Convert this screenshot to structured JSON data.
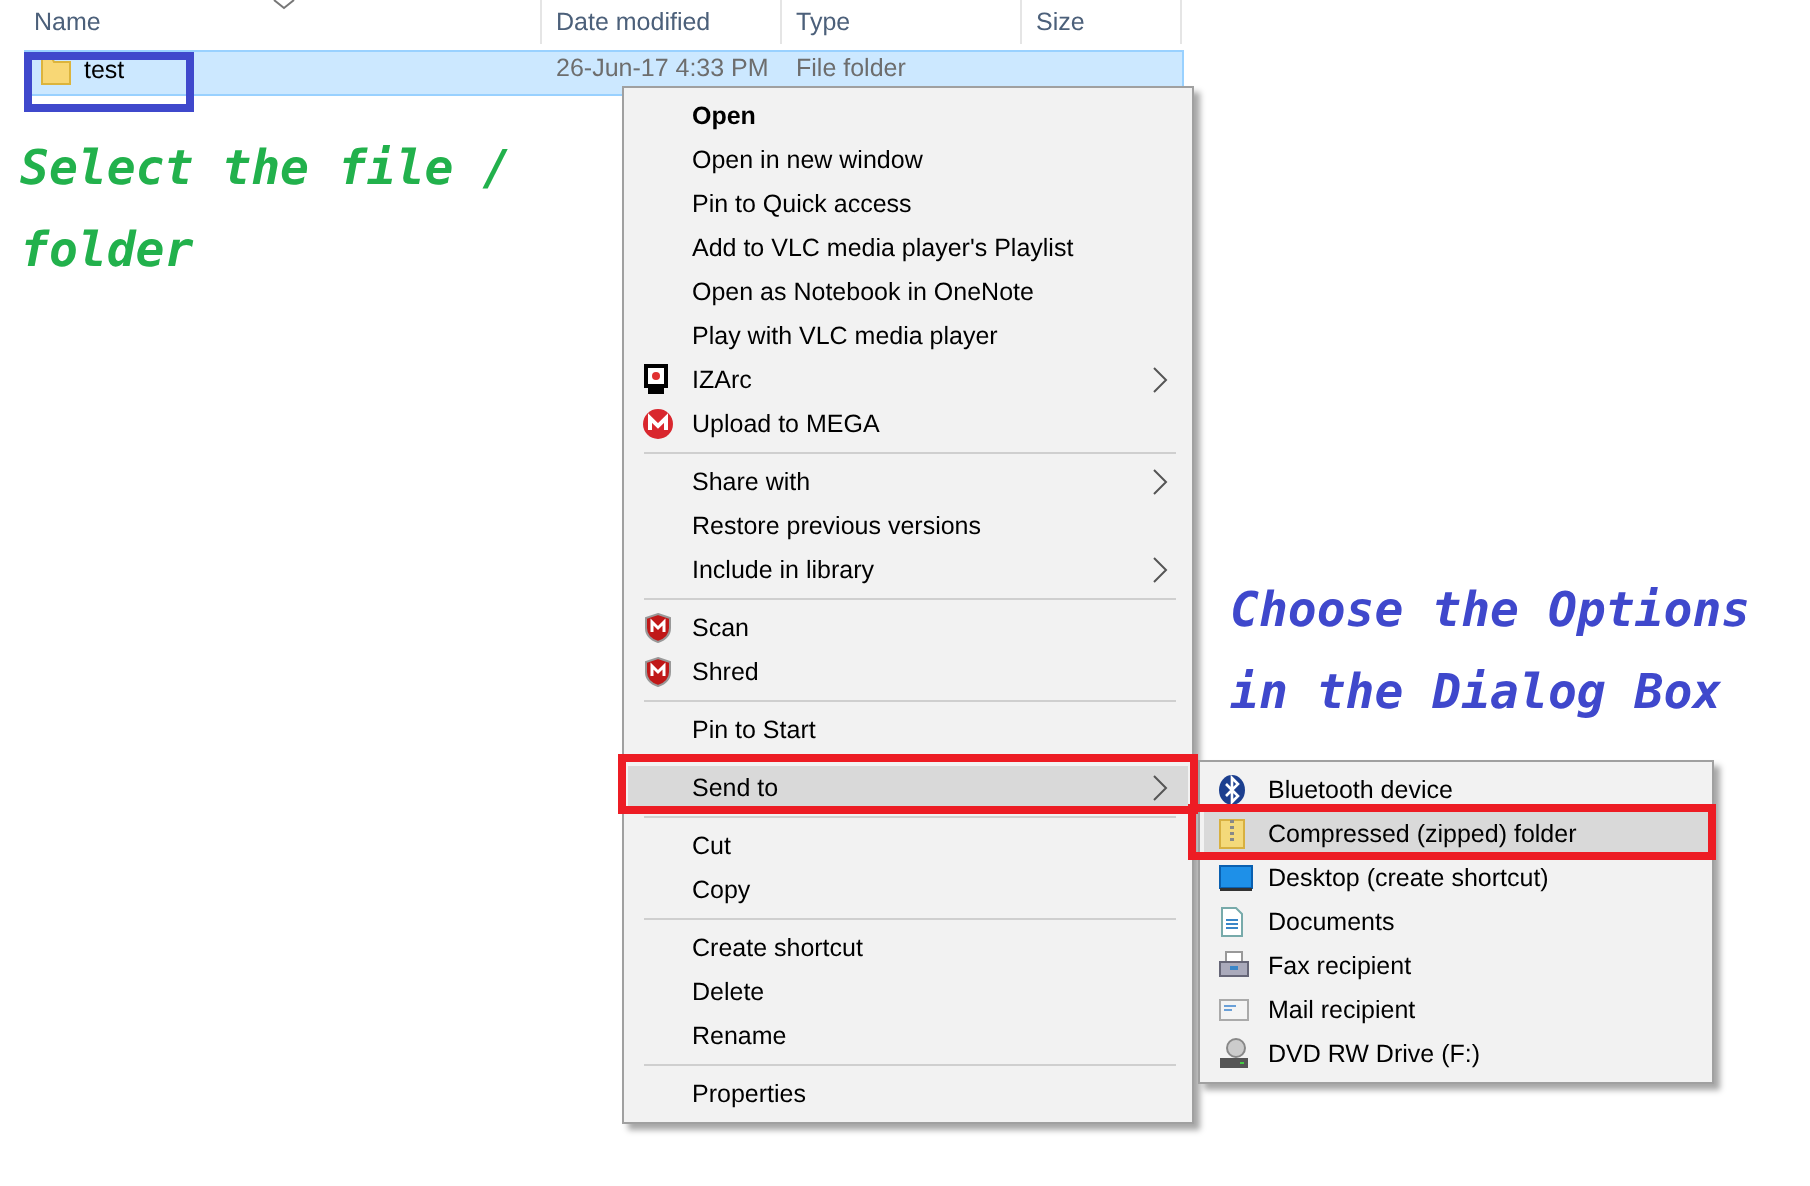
{
  "columns": [
    {
      "label": "Name"
    },
    {
      "label": "Date modified"
    },
    {
      "label": "Type"
    },
    {
      "label": "Size"
    }
  ],
  "rows": [
    {
      "name": "test",
      "date": "26-Jun-17 4:33 PM",
      "type": "File folder",
      "selected": true
    }
  ],
  "annotations": [
    {
      "kind": "note",
      "lines": [
        "Select the file /",
        "folder"
      ],
      "color": "#22b14c"
    },
    {
      "kind": "note",
      "lines": [
        "Choose the Options",
        "in the Dialog Box"
      ],
      "color": "#3f48cc"
    }
  ],
  "context_menu": {
    "groups": [
      [
        {
          "label": "Open",
          "bold": true,
          "submenu": false,
          "selected": false
        },
        {
          "label": "Open in new window",
          "submenu": false,
          "selected": false
        },
        {
          "label": "Pin to Quick access",
          "submenu": false,
          "selected": false
        },
        {
          "label": "Add to VLC media player's Playlist",
          "submenu": false,
          "selected": false
        },
        {
          "label": "Open as Notebook in OneNote",
          "submenu": false,
          "selected": false
        },
        {
          "label": "Play with VLC media player",
          "submenu": false,
          "selected": false
        },
        {
          "label": "IZArc",
          "kind": "izarc",
          "submenu": true,
          "selected": false
        },
        {
          "label": "Upload to MEGA",
          "kind": "mega",
          "submenu": false,
          "selected": false
        }
      ],
      [
        {
          "label": "Share with",
          "submenu": true,
          "selected": false
        },
        {
          "label": "Restore previous versions",
          "submenu": false,
          "selected": false
        },
        {
          "label": "Include in library",
          "submenu": true,
          "selected": false
        }
      ],
      [
        {
          "label": "Scan",
          "kind": "shield",
          "submenu": false,
          "selected": false
        },
        {
          "label": "Shred",
          "kind": "shield",
          "submenu": false,
          "selected": false
        }
      ],
      [
        {
          "label": "Pin to Start",
          "submenu": false,
          "selected": false
        }
      ],
      [
        {
          "label": "Send to",
          "submenu": true,
          "selected": true
        }
      ],
      [
        {
          "label": "Cut",
          "submenu": false,
          "selected": false
        },
        {
          "label": "Copy",
          "submenu": false,
          "selected": false
        }
      ],
      [
        {
          "label": "Create shortcut",
          "submenu": false,
          "selected": false
        },
        {
          "label": "Delete",
          "submenu": false,
          "selected": false
        },
        {
          "label": "Rename",
          "submenu": false,
          "selected": false
        }
      ],
      [
        {
          "label": "Properties",
          "submenu": false,
          "selected": false
        }
      ]
    ]
  },
  "send_to_menu": [
    {
      "label": "Bluetooth device",
      "kind": "bluetooth",
      "selected": false
    },
    {
      "label": "Compressed (zipped) folder",
      "kind": "zip",
      "selected": true
    },
    {
      "label": "Desktop (create shortcut)",
      "kind": "desktop",
      "selected": false
    },
    {
      "label": "Documents",
      "kind": "document",
      "selected": false
    },
    {
      "label": "Fax recipient",
      "kind": "fax",
      "selected": false
    },
    {
      "label": "Mail recipient",
      "kind": "mail",
      "selected": false
    },
    {
      "label": "DVD RW Drive (F:)",
      "kind": "dvd",
      "selected": false
    }
  ]
}
